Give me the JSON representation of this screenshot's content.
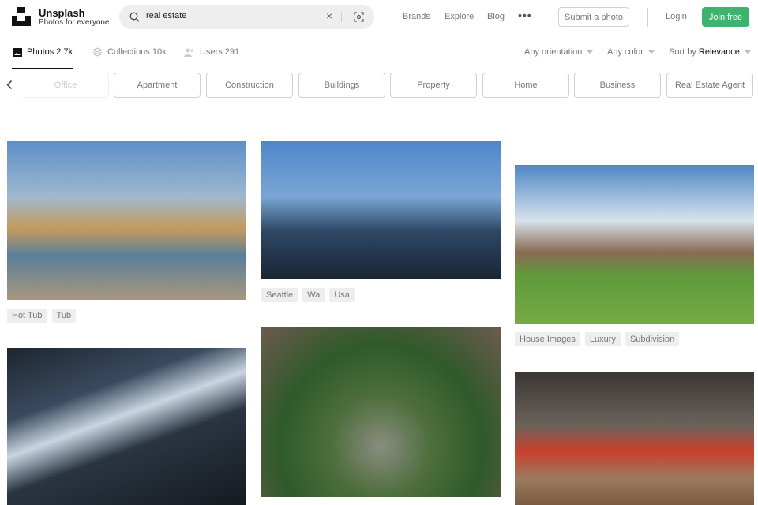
{
  "header": {
    "brand": "Unsplash",
    "tagline": "Photos for everyone",
    "search_value": "real estate",
    "nav": [
      "Brands",
      "Explore",
      "Blog"
    ],
    "submit_label": "Submit a photo",
    "login_label": "Login",
    "join_label": "Join free",
    "accent": "#3cb46e"
  },
  "tabs": [
    {
      "label": "Photos 2.7k",
      "icon": "image-icon"
    },
    {
      "label": "Collections 10k",
      "icon": "collections-icon"
    },
    {
      "label": "Users 291",
      "icon": "users-icon"
    }
  ],
  "filters": {
    "orientation": "Any orientation",
    "color": "Any color",
    "sort_prefix": "Sort by",
    "sort_value": "Relevance"
  },
  "chips": [
    "Office",
    "Apartment",
    "Construction",
    "Buildings",
    "Property",
    "Home",
    "Business",
    "Real Estate Agent"
  ],
  "photos": [
    {
      "tags": [
        "Hot Tub",
        "Tub"
      ]
    },
    {
      "tags": []
    },
    {
      "tags": [
        "Seattle",
        "Wa",
        "Usa"
      ]
    },
    {
      "tags": []
    },
    {
      "tags": [
        "House Images",
        "Luxury",
        "Subdivision"
      ]
    },
    {
      "tags": []
    }
  ]
}
